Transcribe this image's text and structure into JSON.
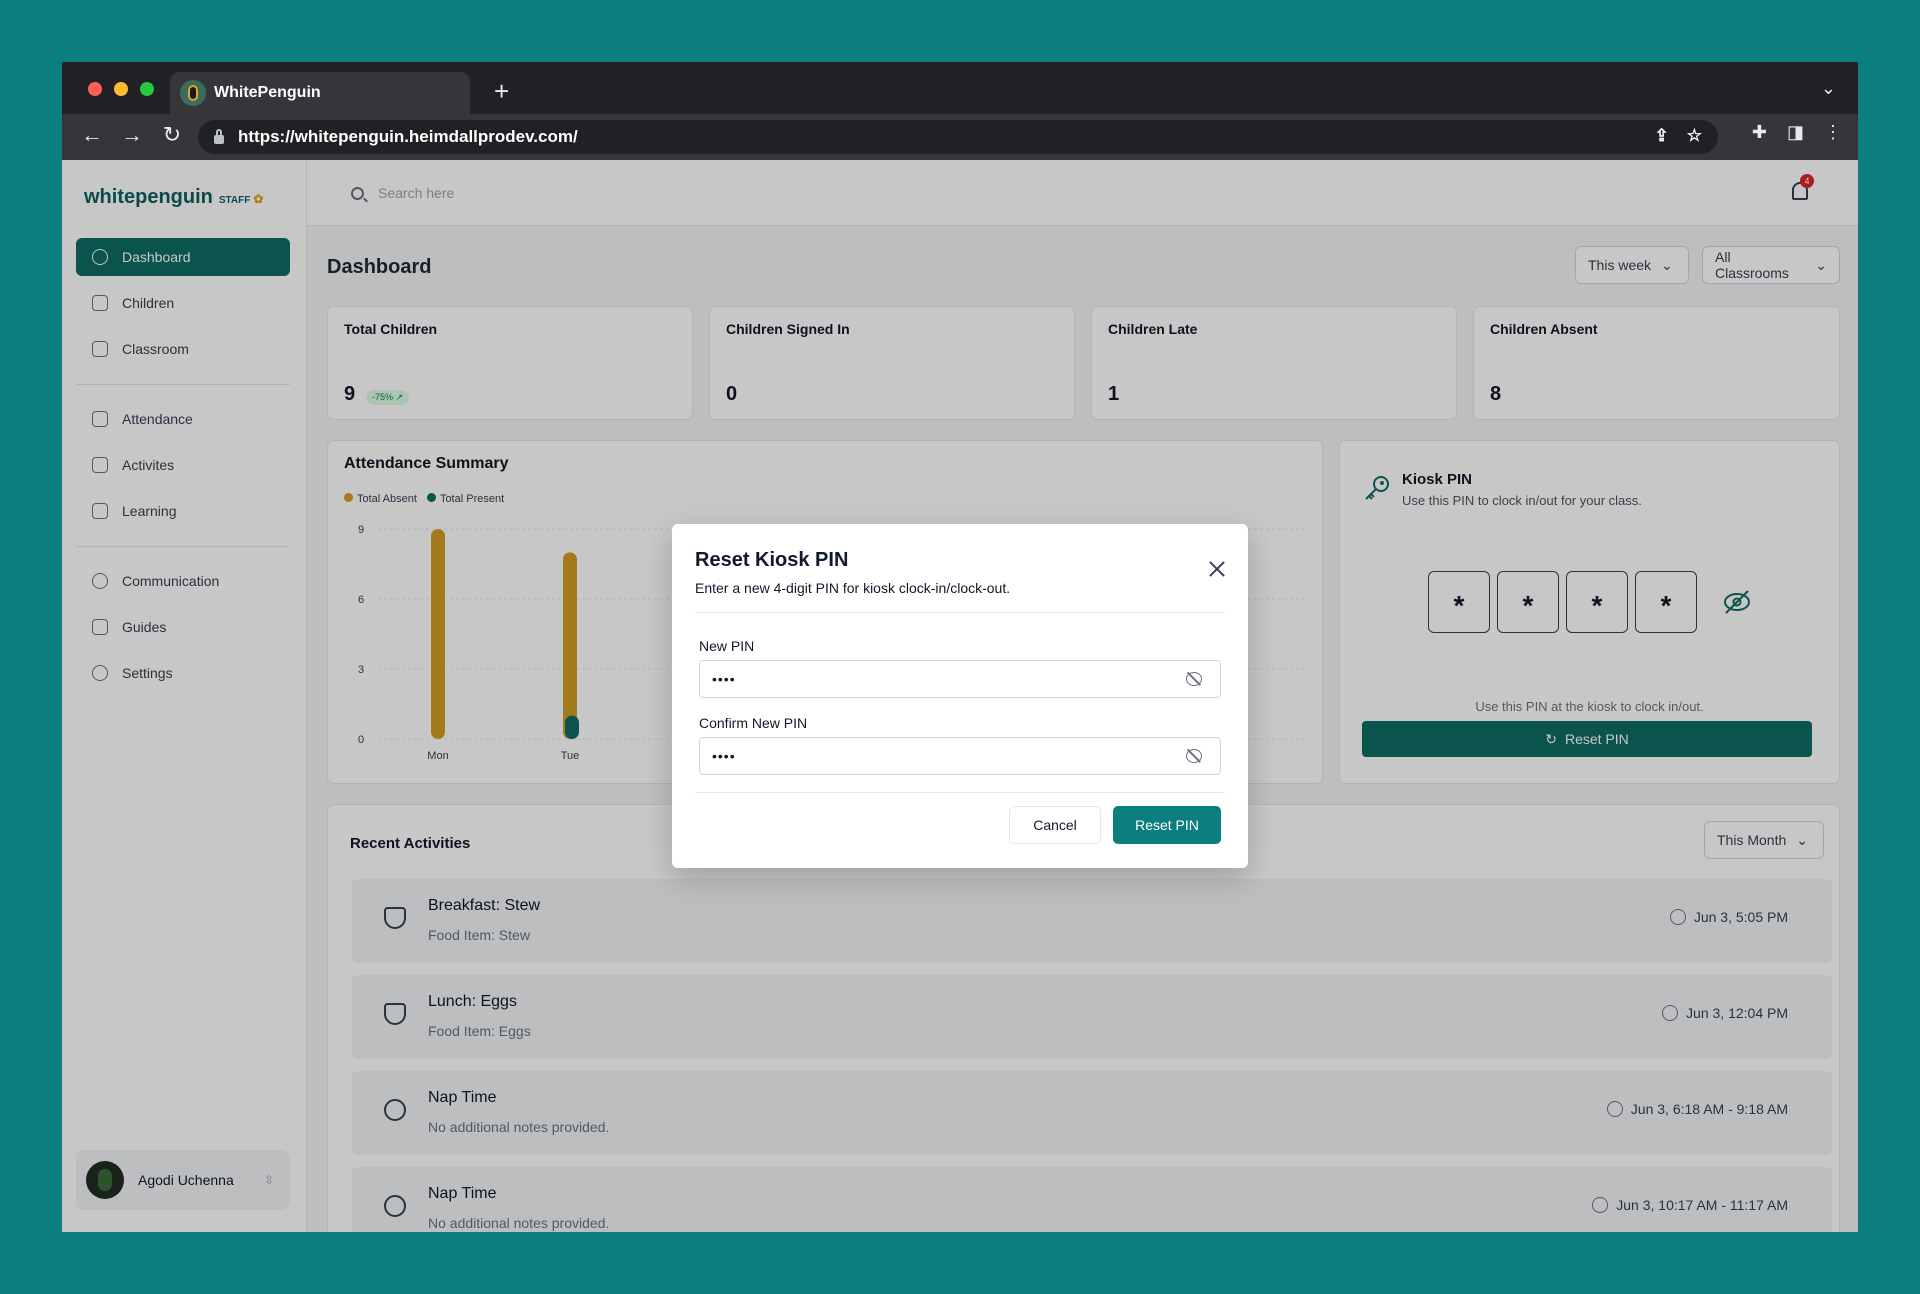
{
  "browser": {
    "tab_title": "WhitePenguin",
    "url": "https://whitepenguin.heimdallprodev.com/",
    "new_tab": "+"
  },
  "sidebar": {
    "logo": "whitepenguin",
    "logo_tag": "STAFF",
    "items": [
      {
        "label": "Dashboard"
      },
      {
        "label": "Children"
      },
      {
        "label": "Classroom"
      },
      {
        "label": "Attendance"
      },
      {
        "label": "Activites"
      },
      {
        "label": "Learning"
      },
      {
        "label": "Communication"
      },
      {
        "label": "Guides"
      },
      {
        "label": "Settings"
      }
    ],
    "user_name": "Agodi Uchenna"
  },
  "topbar": {
    "search_placeholder": "Search here",
    "notification_count": "4"
  },
  "dashboard": {
    "title": "Dashboard",
    "period_filter": "This week",
    "classroom_filter": "All Classrooms",
    "stats": [
      {
        "label": "Total Children",
        "value": "9",
        "change": "-75% ↗"
      },
      {
        "label": "Children Signed In",
        "value": "0"
      },
      {
        "label": "Children Late",
        "value": "1"
      },
      {
        "label": "Children Absent",
        "value": "8"
      }
    ],
    "attendance": {
      "title": "Attendance Summary",
      "legend_absent": "Total Absent",
      "legend_present": "Total Present",
      "absent_color": "#d39e22",
      "present_color": "#0f6b63"
    },
    "kiosk": {
      "title": "Kiosk PIN",
      "subtitle": "Use this PIN to clock in/out for your class.",
      "pin_digits": [
        "*",
        "*",
        "*",
        "*"
      ],
      "note": "Use this PIN at the kiosk to clock in/out.",
      "reset_label": "Reset PIN"
    },
    "recent": {
      "title": "Recent Activities",
      "filter": "This Month",
      "items": [
        {
          "title": "Breakfast: Stew",
          "sub": "Food Item: Stew",
          "time": "Jun 3, 5:05 PM"
        },
        {
          "title": "Lunch: Eggs",
          "sub": "Food Item: Eggs",
          "time": "Jun 3, 12:04 PM"
        },
        {
          "title": "Nap Time",
          "sub": "No additional notes provided.",
          "time": "Jun 3, 6:18 AM - 9:18 AM"
        },
        {
          "title": "Nap Time",
          "sub": "No additional notes provided.",
          "time": "Jun 3, 10:17 AM - 11:17 AM"
        }
      ]
    }
  },
  "chart_data": {
    "type": "bar",
    "categories": [
      "Mon",
      "Tue"
    ],
    "series": [
      {
        "name": "Total Absent",
        "values": [
          9,
          8
        ]
      },
      {
        "name": "Total Present",
        "values": [
          0,
          1
        ]
      }
    ],
    "yticks": [
      "0",
      "3",
      "6",
      "9"
    ],
    "ylim": [
      0,
      9
    ]
  },
  "modal": {
    "title": "Reset Kiosk PIN",
    "subtitle": "Enter a new 4-digit PIN for kiosk clock-in/clock-out.",
    "new_pin_label": "New PIN",
    "new_pin_value": "••••",
    "confirm_label": "Confirm New PIN",
    "confirm_value": "••••",
    "cancel_label": "Cancel",
    "submit_label": "Reset PIN"
  }
}
